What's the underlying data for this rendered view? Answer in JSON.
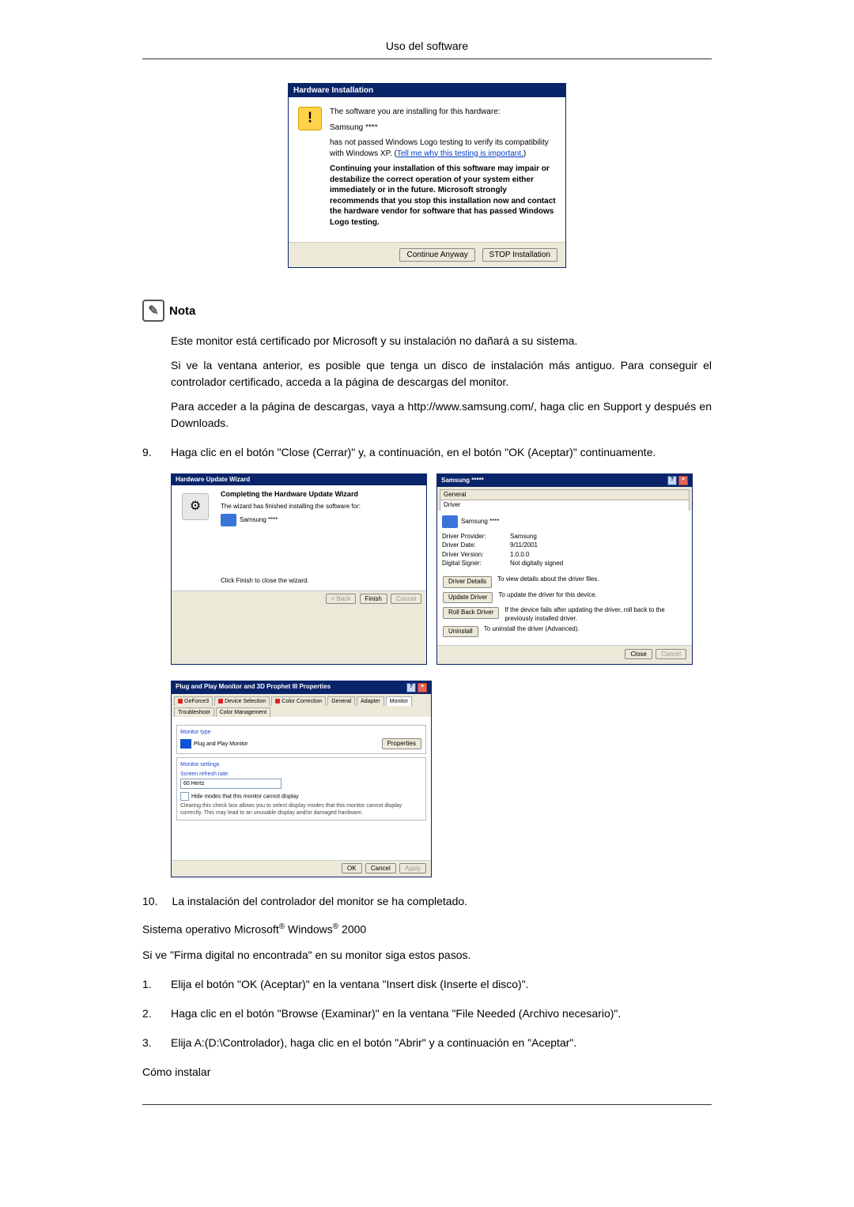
{
  "header": {
    "title": "Uso del software"
  },
  "hw_install": {
    "title": "Hardware Installation",
    "line1": "The software you are installing for this hardware:",
    "device": "Samsung ****",
    "line2_pre": "has not passed Windows Logo testing to verify its compatibility with Windows XP. (",
    "line2_link": "Tell me why this testing is important.",
    "line2_post": ")",
    "warn": "Continuing your installation of this software may impair or destabilize the correct operation of your system either immediately or in the future. Microsoft strongly recommends that you stop this installation now and contact the hardware vendor for software that has passed Windows Logo testing.",
    "btn_continue": "Continue Anyway",
    "btn_stop": "STOP Installation"
  },
  "nota": {
    "label": "Nota",
    "p1": "Este monitor está certificado por Microsoft y su instalación no dañará a su sistema.",
    "p2": "Si ve la ventana anterior, es posible que tenga un disco de instalación más antiguo. Para conseguir el controlador certificado, acceda a la página de descargas del monitor.",
    "p3": "Para acceder a la página de descargas, vaya a http://www.samsung.com/, haga clic en Support y después en Downloads."
  },
  "step9": {
    "num": "9.",
    "text": "Haga clic en el botón \"Close (Cerrar)\" y, a continuación, en el botón \"OK (Aceptar)\" continuamente."
  },
  "wizard": {
    "title": "Hardware Update Wizard",
    "heading": "Completing the Hardware Update Wizard",
    "line1": "The wizard has finished installing the software for:",
    "device": "Samsung ****",
    "line_close": "Click Finish to close the wizard.",
    "btn_back": "< Back",
    "btn_finish": "Finish",
    "btn_cancel": "Cancel"
  },
  "driver_props": {
    "title": "Samsung *****",
    "tab_general": "General",
    "tab_driver": "Driver",
    "device": "Samsung ****",
    "provider_k": "Driver Provider:",
    "provider_v": "Samsung",
    "date_k": "Driver Date:",
    "date_v": "9/11/2001",
    "version_k": "Driver Version:",
    "version_v": "1.0.0.0",
    "signer_k": "Digital Signer:",
    "signer_v": "Not digitally signed",
    "btn_details": "Driver Details",
    "btn_details_desc": "To view details about the driver files.",
    "btn_update": "Update Driver",
    "btn_update_desc": "To update the driver for this device.",
    "btn_rollback": "Roll Back Driver",
    "btn_rollback_desc": "If the device fails after updating the driver, roll back to the previously installed driver.",
    "btn_uninstall": "Uninstall",
    "btn_uninstall_desc": "To uninstall the driver (Advanced).",
    "btn_close": "Close",
    "btn_cancel": "Cancel"
  },
  "display_props": {
    "title": "Plug and Play Monitor and 3D Prophet III Properties",
    "tab_geforce": "GeForce3",
    "tab_devsel": "Device Selection",
    "tab_colorcorr": "Color Correction",
    "tab_general": "General",
    "tab_adapter": "Adapter",
    "tab_monitor": "Monitor",
    "tab_troubleshoot": "Troubleshoot",
    "tab_colormgmt": "Color Management",
    "group_monitor_type": "Monitor type",
    "monitor_name": "Plug and Play Monitor",
    "btn_properties": "Properties",
    "group_settings": "Monitor settings",
    "label_refresh": "Screen refresh rate:",
    "refresh_value": "60 Hertz",
    "chk_hide": "Hide modes that this monitor cannot display",
    "hide_desc": "Clearing this check box allows you to select display modes that this monitor cannot display correctly. This may lead to an unusable display and/or damaged hardware.",
    "btn_ok": "OK",
    "btn_cancel": "Cancel",
    "btn_apply": "Apply"
  },
  "step10": {
    "num": "10.",
    "text": "La instalación del controlador del monitor se ha completado."
  },
  "os_line": {
    "pre": "Sistema operativo Microsoft",
    "mid": " Windows",
    "post": " 2000",
    "reg": "®"
  },
  "signature_line": "Si ve \"Firma digital no encontrada\" en su monitor siga estos pasos.",
  "s2000_1": {
    "num": "1.",
    "text": "Elija el botón \"OK (Aceptar)\" en la ventana \"Insert disk (Inserte el disco)\"."
  },
  "s2000_2": {
    "num": "2.",
    "text": "Haga clic en el botón \"Browse (Examinar)\" en la ventana \"File Needed (Archivo necesario)\"."
  },
  "s2000_3": {
    "num": "3.",
    "text": "Elija A:(D:\\Controlador), haga clic en el botón \"Abrir\" y a continuación en \"Aceptar\"."
  },
  "como_instalar": "Cómo instalar"
}
